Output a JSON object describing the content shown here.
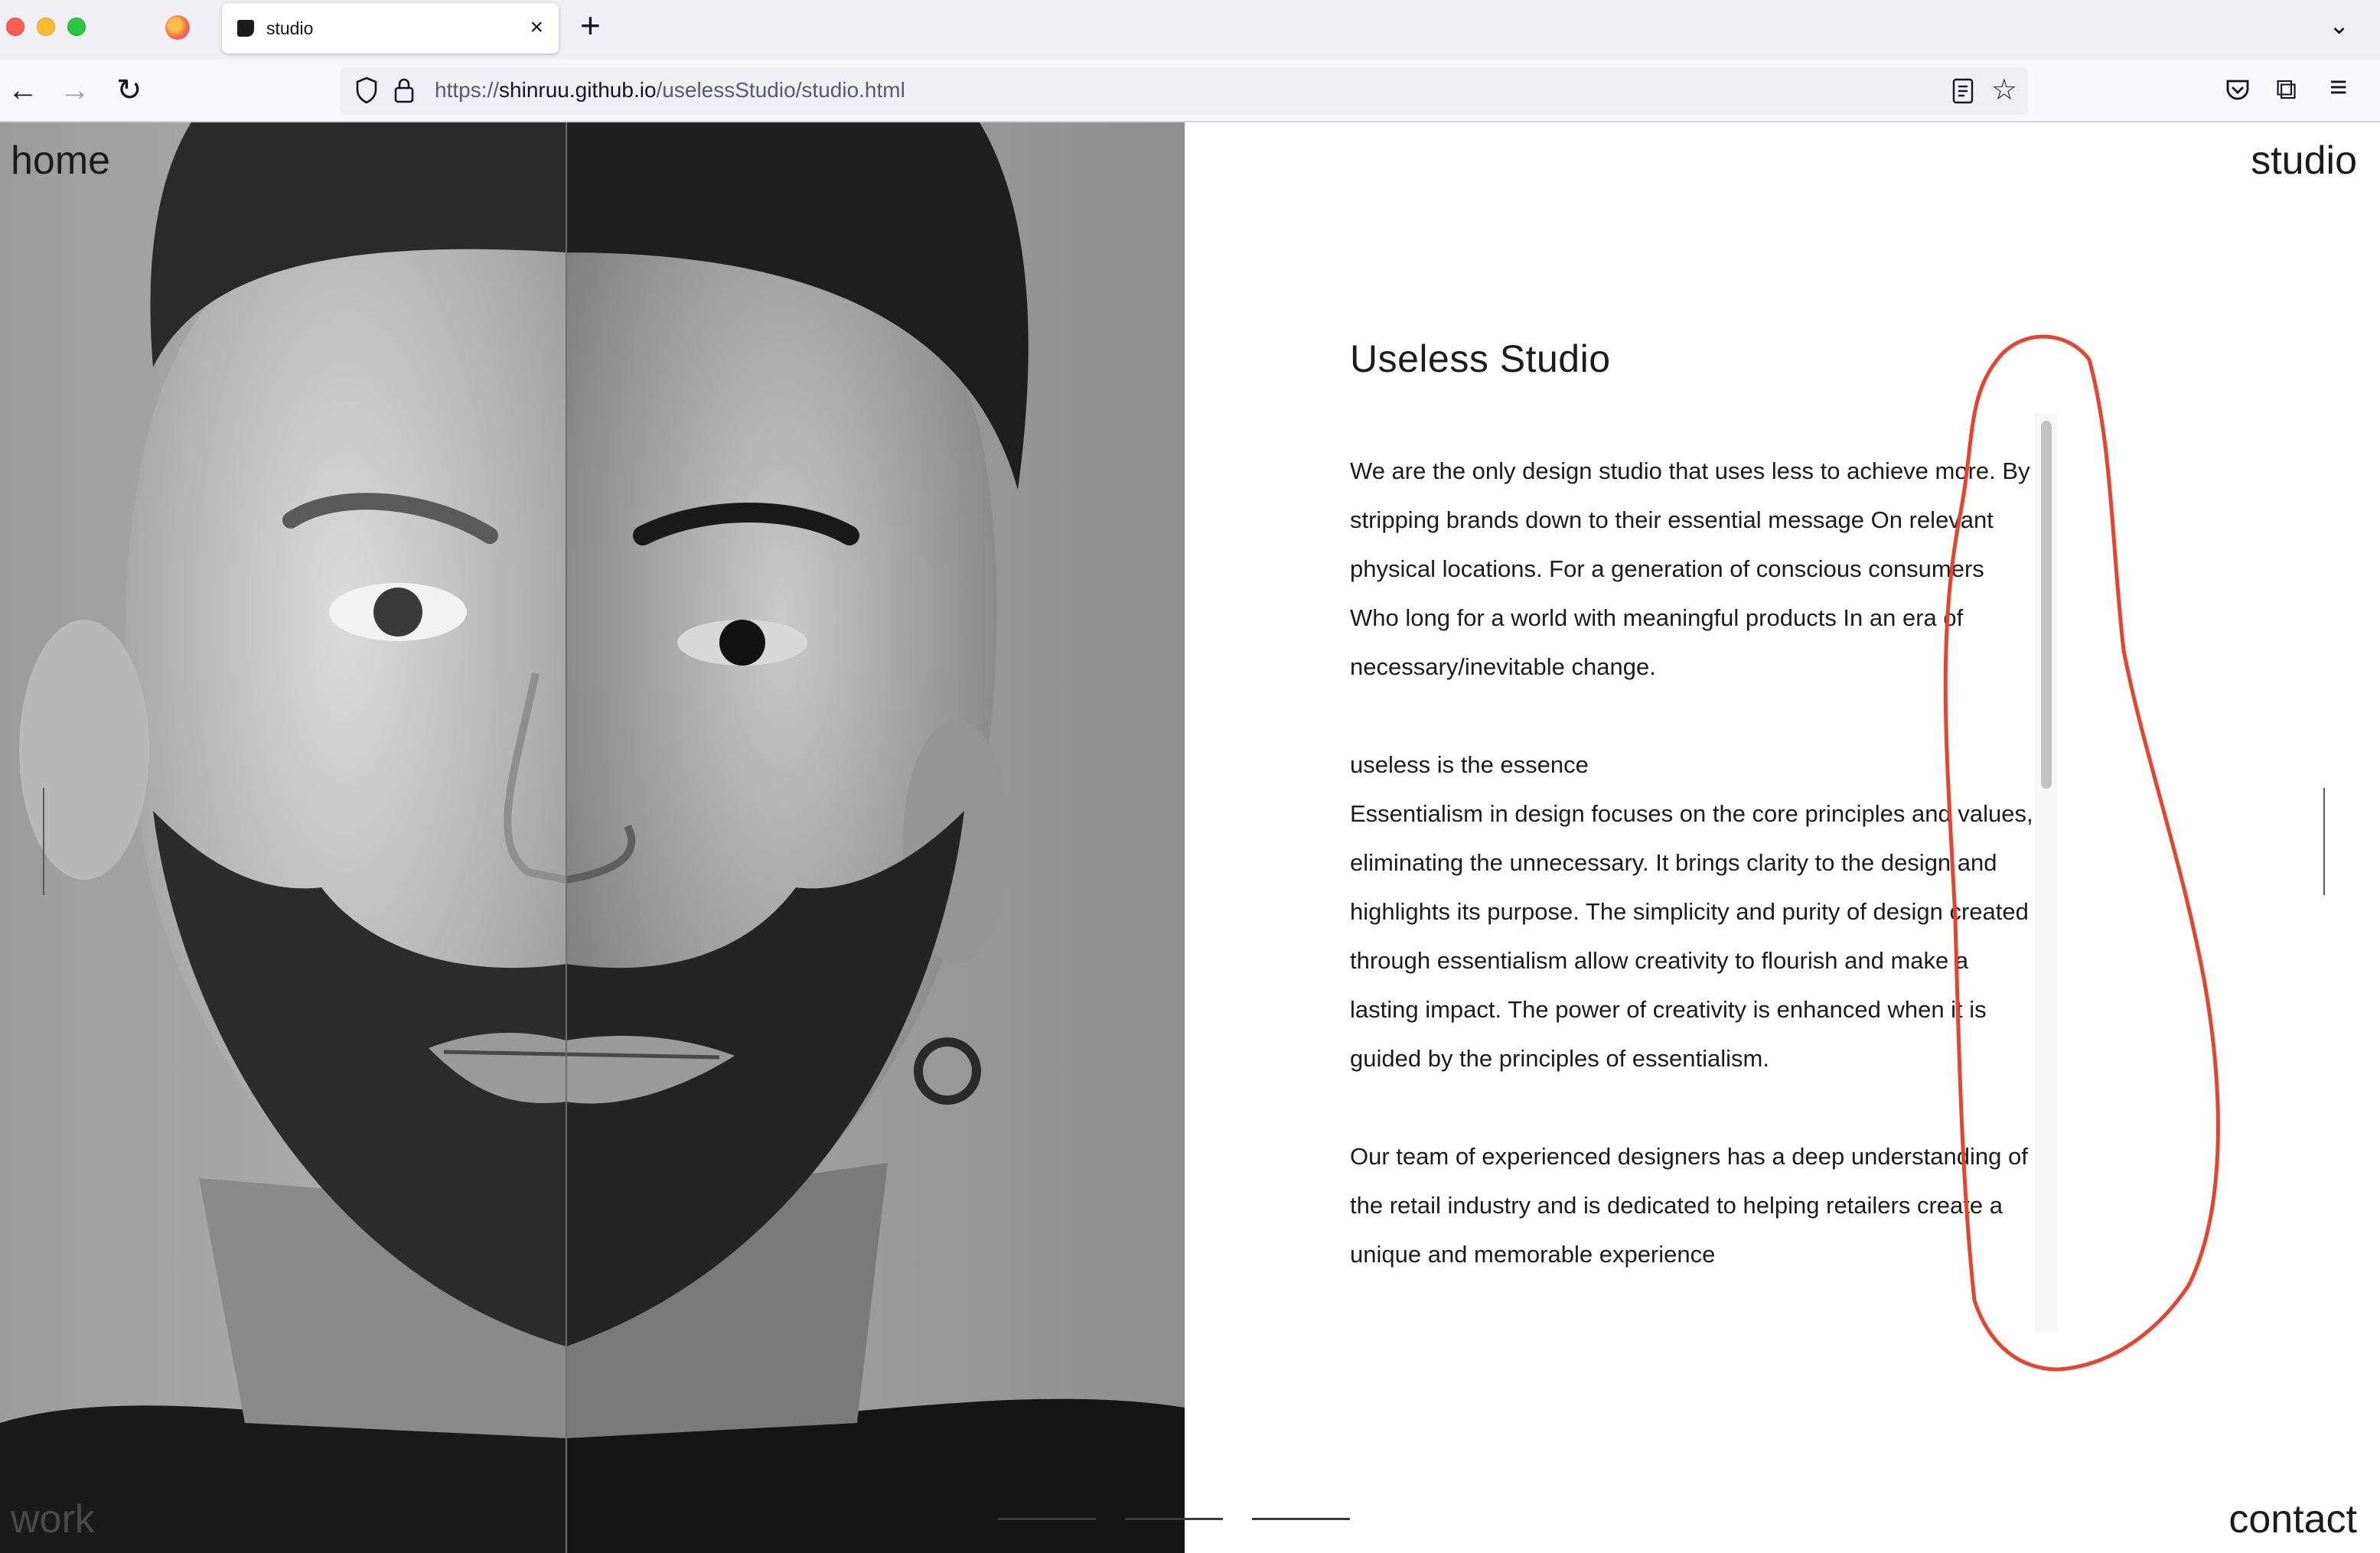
{
  "browser": {
    "tab_title": "studio",
    "tab_close": "×",
    "new_tab": "+",
    "tab_list": "⌄",
    "back": "←",
    "forward": "→",
    "reload": "↻",
    "url_prefix": "https://",
    "url_host": "shinruu.github.io",
    "url_path": "/uselessStudio/studio.html",
    "star": "☆",
    "extensions": "⧉",
    "menu": "≡"
  },
  "nav": {
    "home": "home",
    "studio": "studio",
    "work": "work",
    "contact": "contact"
  },
  "content": {
    "heading": "Useless Studio",
    "intro": "We are the only design studio that uses less to achieve more. By stripping brands down to their essential message On relevant physical locations. For a generation of conscious consumers Who long for a world with meaningful products In an era of necessary/inevitable change.",
    "essence_title": "useless is the essence",
    "essence_body": "Essentialism in design focuses on the core principles and values, eliminating the unnecessary. It brings clarity to the design and highlights its purpose. The simplicity and purity of design created through essentialism allow creativity to flourish and make a lasting impact. The power of creativity is enhanced when it is guided by the principles of essentialism.",
    "team": "Our team of experienced designers has a deep understanding of the retail industry and is dedicated to helping retailers create a unique and memorable experience"
  },
  "scroll": {
    "thumb_fraction": 0.4
  },
  "colors": {
    "annotation": "#e8432c"
  }
}
